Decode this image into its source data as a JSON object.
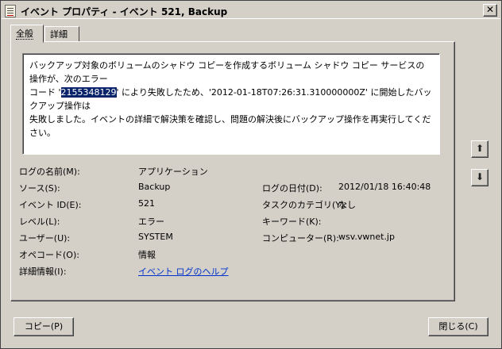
{
  "window": {
    "title": "イベント プロパティ - イベント 521, Backup",
    "close_glyph": "✕"
  },
  "tabs": [
    {
      "label": "全般",
      "active": true
    },
    {
      "label": "詳細",
      "active": false
    }
  ],
  "description": {
    "line1": "バックアップ対象のボリュームのシャドウ コピーを作成するボリューム シャドウ コピー サービスの操作が、次のエラー",
    "line2_pre": "コード '",
    "line2_sel": "2155348129",
    "line2_post": "' により失敗したため、'2012-01-18T07:26:31.310000000Z' に開始したバックアップ操作は",
    "line3": "失敗しました。イベントの詳細で解決策を確認し、問題の解決後にバックアップ操作を再実行してください。"
  },
  "fields": {
    "log_name": {
      "label": "ログの名前(M):",
      "value": "アプリケーション"
    },
    "source": {
      "label": "ソース(S):",
      "value": "Backup"
    },
    "logged": {
      "label": "ログの日付(D):",
      "value": "2012/01/18 16:40:48"
    },
    "event_id": {
      "label": "イベント ID(E):",
      "value": "521"
    },
    "task_category": {
      "label": "タスクのカテゴリ(Y):",
      "value": "なし"
    },
    "level": {
      "label": "レベル(L):",
      "value": "エラー"
    },
    "keywords": {
      "label": "キーワード(K):",
      "value": ""
    },
    "user": {
      "label": "ユーザー(U):",
      "value": "SYSTEM"
    },
    "computer": {
      "label": "コンピューター(R):",
      "value": "wsv.vwnet.jp"
    },
    "opcode": {
      "label": "オペコード(O):",
      "value": "情報"
    },
    "more_info": {
      "label": "詳細情報(I):",
      "value": "イベント ログのヘルプ"
    }
  },
  "nav": {
    "up_glyph": "⬆",
    "down_glyph": "⬇"
  },
  "buttons": {
    "copy": "コピー(P)",
    "close": "閉じる(C)"
  }
}
